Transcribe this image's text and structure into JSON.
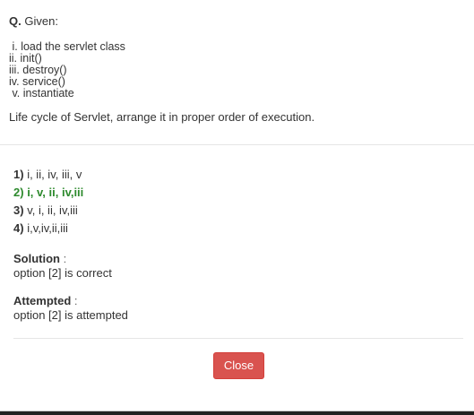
{
  "question": {
    "prefix": "Q.",
    "lead": "Given:",
    "steps": [
      " i. load the servlet class",
      "ii. init()",
      "iii. destroy()",
      "iv. service()",
      " v. instantiate"
    ],
    "text": "Life cycle of Servlet, arrange it in proper order of execution."
  },
  "options": [
    {
      "number": "1)",
      "text": "i, ii, iv, iii, v",
      "correct": false
    },
    {
      "number": "2)",
      "text": "i, v, ii, iv,iii",
      "correct": true
    },
    {
      "number": "3)",
      "text": "v, i, ii, iv,iii",
      "correct": false
    },
    {
      "number": "4)",
      "text": "i,v,iv,ii,iii",
      "correct": false
    }
  ],
  "solution": {
    "label": "Solution",
    "colon": ":",
    "text": "option [2] is correct"
  },
  "attempted": {
    "label": "Attempted",
    "colon": ":",
    "text": "option [2] is attempted"
  },
  "footer": {
    "close_label": "Close"
  },
  "colors": {
    "correct": "#2d8a2d",
    "close_button": "#d9534f"
  }
}
